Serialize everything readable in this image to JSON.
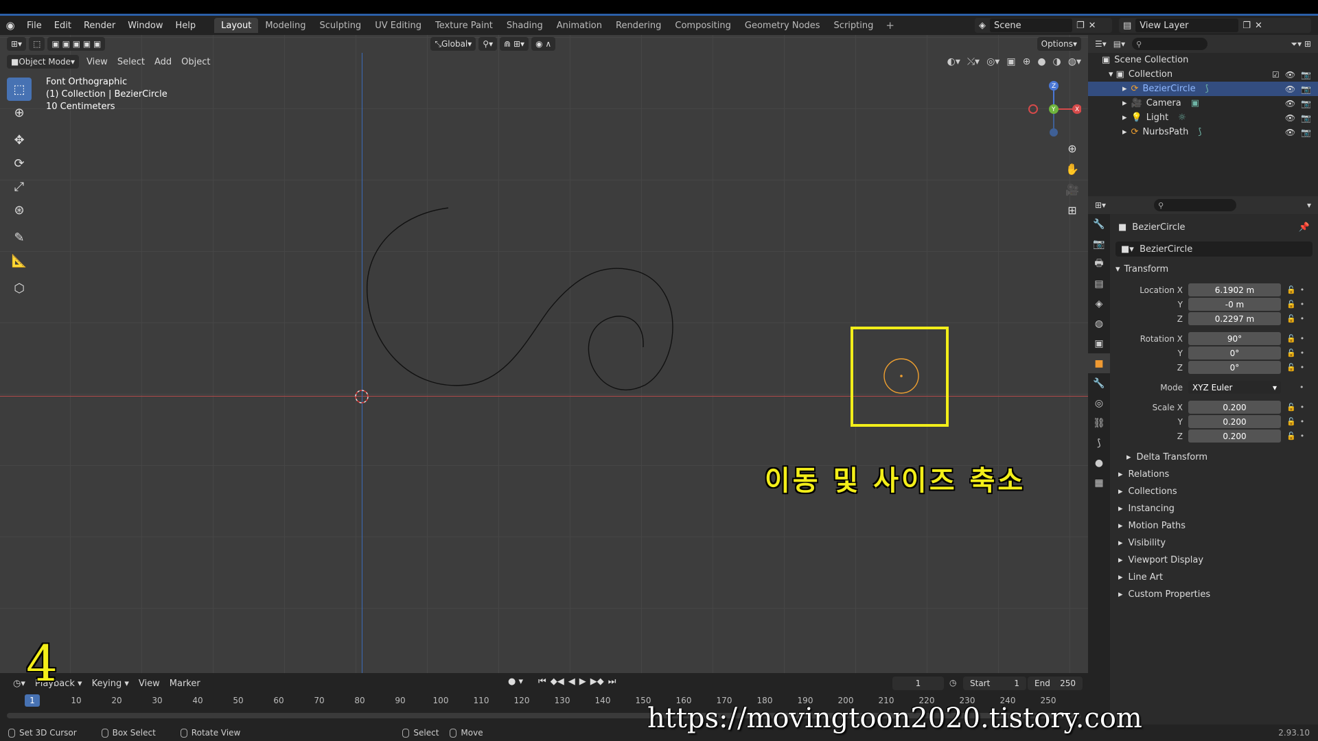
{
  "menubar": {
    "items": [
      "File",
      "Edit",
      "Render",
      "Window",
      "Help"
    ],
    "workspaces": [
      "Layout",
      "Modeling",
      "Sculpting",
      "UV Editing",
      "Texture Paint",
      "Shading",
      "Animation",
      "Rendering",
      "Compositing",
      "Geometry Nodes",
      "Scripting"
    ],
    "active_workspace": "Layout",
    "scene": "Scene",
    "view_layer": "View Layer"
  },
  "viewport": {
    "mode": "Object Mode",
    "menus": [
      "View",
      "Select",
      "Add",
      "Object"
    ],
    "orientation": "Global",
    "options": "Options",
    "info": {
      "view": "Font Orthographic",
      "collection": "(1) Collection | BezierCircle",
      "scale": "10 Centimeters"
    },
    "caption": "이동 및 사이즈 축소"
  },
  "outliner": {
    "root": "Scene Collection",
    "collection": "Collection",
    "items": [
      {
        "name": "BezierCircle",
        "selected": true
      },
      {
        "name": "Camera",
        "selected": false
      },
      {
        "name": "Light",
        "selected": false
      },
      {
        "name": "NurbsPath",
        "selected": false
      }
    ]
  },
  "properties": {
    "object_name": "BezierCircle",
    "object_field": "BezierCircle",
    "transform_label": "Transform",
    "location": {
      "label": "Location X",
      "x": "6.1902 m",
      "y": "-0 m",
      "z": "0.2297 m"
    },
    "rotation": {
      "label": "Rotation X",
      "x": "90°",
      "y": "0°",
      "z": "0°"
    },
    "mode": {
      "label": "Mode",
      "value": "XYZ Euler"
    },
    "scale": {
      "label": "Scale X",
      "x": "0.200",
      "y": "0.200",
      "z": "0.200"
    },
    "axis_y": "Y",
    "axis_z": "Z",
    "delta_transform": "Delta Transform",
    "sections": [
      "Relations",
      "Collections",
      "Instancing",
      "Motion Paths",
      "Visibility",
      "Viewport Display",
      "Line Art",
      "Custom Properties"
    ]
  },
  "timeline": {
    "menus": [
      "Playback",
      "Keying",
      "View",
      "Marker"
    ],
    "current_frame": "1",
    "start_label": "Start",
    "start": "1",
    "end_label": "End",
    "end": "250",
    "ruler": [
      "10",
      "20",
      "30",
      "40",
      "50",
      "60",
      "70",
      "80",
      "90",
      "100",
      "110",
      "120",
      "130",
      "140",
      "150",
      "160",
      "170",
      "180",
      "190",
      "200",
      "210",
      "220",
      "230",
      "240",
      "250"
    ],
    "playhead": "1"
  },
  "statusbar": {
    "items": [
      "Set 3D Cursor",
      "Box Select",
      "Rotate View",
      "Select",
      "Move"
    ],
    "version": "2.93.10"
  },
  "watermark": {
    "number": "4",
    "url": "https://movingtoon2020.tistory.com"
  },
  "colors": {
    "accent": "#4772b3",
    "highlight": "#f2ee1a",
    "x_axis": "#b34a4a",
    "y_axis": "#3b6bb8"
  }
}
